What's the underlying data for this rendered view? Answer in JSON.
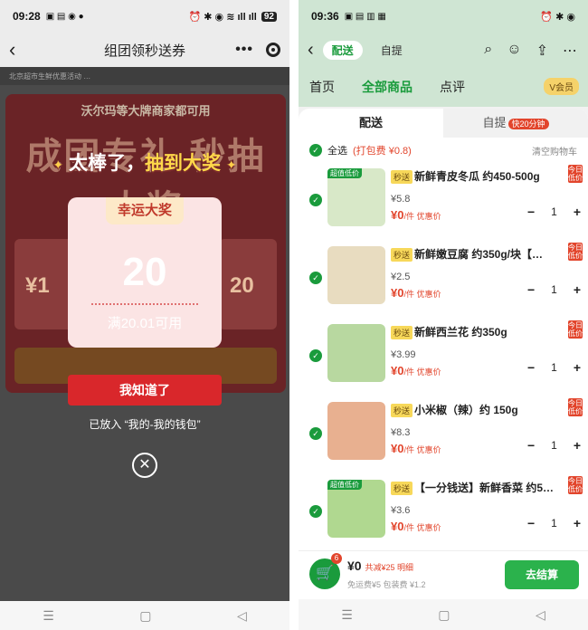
{
  "left": {
    "status": {
      "time": "09:28",
      "battery": "92"
    },
    "header": {
      "title": "组团领秒送券",
      "back": "‹",
      "more": "•••"
    },
    "notice": "北京超市生鲜优惠活动 …",
    "bg_banner": "沃尔玛等大牌商家都可用",
    "bg_headline": "成团专礼 秒抽大奖",
    "bg_coupon_a": "¥1",
    "bg_coupon_b": "20",
    "win_title": {
      "pre": "太棒了，",
      "big": "抽到大奖",
      "stars": "✦"
    },
    "prize": {
      "label": "幸运大奖",
      "amount": "20",
      "condition": "满20.01可用"
    },
    "ok_button": "我知道了",
    "put_note": "已放入 “我的-我的钱包”",
    "close": "✕",
    "nav": [
      "☰",
      "▢",
      "◁"
    ]
  },
  "right": {
    "status": {
      "time": "09:36"
    },
    "top_tabs": [
      "配送",
      "自提"
    ],
    "top_tag": "快20分钟",
    "sub_tabs": [
      "首页",
      "全部商品",
      "点评"
    ],
    "member": "V会员",
    "sheet_tabs": {
      "delivery": "配送",
      "pickup": "自提",
      "pickup_badge": "快20分钟"
    },
    "select_all": {
      "label": "全选",
      "pack_fee": "(打包费 ¥0.8)",
      "clear": "清空购物车"
    },
    "items": [
      {
        "name": "新鲜青皮冬瓜 约450-500g",
        "flash": "秒送",
        "orig": "¥5.8",
        "now": "¥0",
        "unit": "/件 优惠价",
        "qty": "1",
        "tag": "超值低价",
        "day": "今日低价",
        "color": "#d8e8c8"
      },
      {
        "name": "新鲜嫩豆腐 约350g/块【…",
        "flash": "秒送",
        "orig": "¥2.5",
        "now": "¥0",
        "unit": "/件 优惠价",
        "qty": "1",
        "tag": "",
        "day": "今日低价",
        "color": "#e8dcc0"
      },
      {
        "name": "新鲜西兰花 约350g",
        "flash": "秒送",
        "orig": "¥3.99",
        "now": "¥0",
        "unit": "/件 优惠价",
        "qty": "1",
        "tag": "",
        "day": "今日低价",
        "color": "#b8d8a0"
      },
      {
        "name": "小米椒（辣）约 150g",
        "flash": "秒送",
        "orig": "¥8.3",
        "now": "¥0",
        "unit": "/件 优惠价",
        "qty": "1",
        "tag": "",
        "day": "今日低价",
        "color": "#e8b090"
      },
      {
        "name": "【一分钱送】新鲜香菜 约5…",
        "flash": "秒送",
        "orig": "¥3.6",
        "now": "¥0",
        "unit": "/件 优惠价",
        "qty": "1",
        "tag": "超值低价",
        "day": "今日低价",
        "color": "#b0d890"
      }
    ],
    "cart": {
      "badge": "6",
      "total": "¥0",
      "saved": "共减¥25 明细",
      "fees": "免运费¥5  包装费 ¥1.2",
      "checkout": "去结算"
    },
    "nav": [
      "☰",
      "▢",
      "◁"
    ]
  }
}
